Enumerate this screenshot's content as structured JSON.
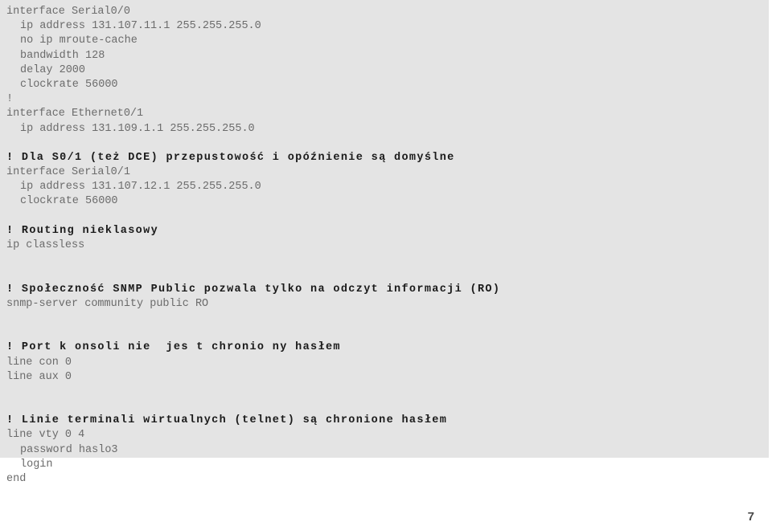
{
  "page": {
    "number": "7",
    "background_color": "#ffffff",
    "block_background_color": "#e4e4e4",
    "code_text_color": "#6b6b6b",
    "comment_text_color": "#1a1a1a"
  },
  "config_block": {
    "lines": [
      {
        "text": "interface Serial0/0",
        "style": "code"
      },
      {
        "text": "ip address 131.107.11.1 255.255.255.0",
        "style": "code-indent"
      },
      {
        "text": "no ip mroute-cache",
        "style": "code-indent"
      },
      {
        "text": "bandwidth 128",
        "style": "code-indent"
      },
      {
        "text": "delay 2000",
        "style": "code-indent"
      },
      {
        "text": "clockrate 56000",
        "style": "code-indent"
      },
      {
        "text": "!",
        "style": "code"
      },
      {
        "text": "interface Ethernet0/1",
        "style": "code"
      },
      {
        "text": "ip address 131.109.1.1 255.255.255.0",
        "style": "code-indent"
      },
      {
        "text": " ",
        "style": "blank"
      },
      {
        "text": "! Dla S0/1 (też DCE) przepustowość i opóźnienie są domyślne",
        "style": "comment"
      },
      {
        "text": "interface Serial0/1",
        "style": "code"
      },
      {
        "text": "ip address 131.107.12.1 255.255.255.0",
        "style": "code-indent"
      },
      {
        "text": "clockrate 56000",
        "style": "code-indent"
      },
      {
        "text": " ",
        "style": "blank"
      },
      {
        "text": "! Routing nieklasowy",
        "style": "comment"
      },
      {
        "text": "ip classless",
        "style": "code"
      },
      {
        "text": " ",
        "style": "blank"
      },
      {
        "text": " ",
        "style": "blank"
      },
      {
        "text": "! Społeczność SNMP Public pozwala tylko na odczyt informacji (RO)",
        "style": "comment"
      },
      {
        "text": "snmp-server community public RO",
        "style": "code"
      },
      {
        "text": " ",
        "style": "blank"
      },
      {
        "text": " ",
        "style": "blank"
      },
      {
        "text": "! Port k onsoli nie  jes t chronio ny hasłem",
        "style": "comment"
      },
      {
        "text": "line con 0",
        "style": "code"
      },
      {
        "text": "line aux 0",
        "style": "code"
      },
      {
        "text": " ",
        "style": "blank"
      },
      {
        "text": " ",
        "style": "blank"
      },
      {
        "text": "! Linie terminali wirtualnych (telnet) są chronione hasłem",
        "style": "comment"
      },
      {
        "text": "line vty 0 4",
        "style": "code"
      },
      {
        "text": "password haslo3",
        "style": "code-indent"
      },
      {
        "text": "login",
        "style": "code-indent"
      },
      {
        "text": "end",
        "style": "code"
      }
    ]
  }
}
